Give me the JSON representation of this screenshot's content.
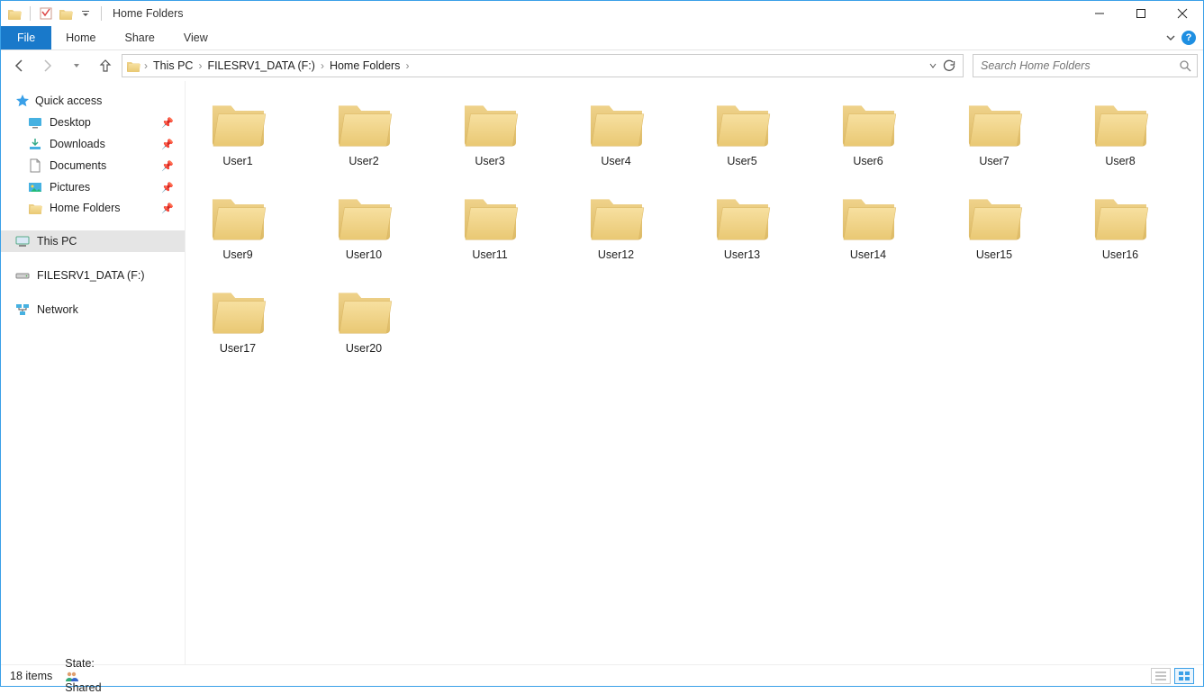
{
  "title": "Home Folders",
  "ribbon": {
    "file": "File",
    "tabs": [
      "Home",
      "Share",
      "View"
    ]
  },
  "breadcrumbs": [
    "This PC",
    "FILESRV1_DATA (F:)",
    "Home Folders"
  ],
  "search": {
    "placeholder": "Search Home Folders"
  },
  "sidebar": {
    "quick_access": "Quick access",
    "quick_items": [
      {
        "label": "Desktop",
        "icon": "desktop",
        "pinned": true
      },
      {
        "label": "Downloads",
        "icon": "downloads",
        "pinned": true
      },
      {
        "label": "Documents",
        "icon": "documents",
        "pinned": true
      },
      {
        "label": "Pictures",
        "icon": "pictures",
        "pinned": true
      },
      {
        "label": "Home Folders",
        "icon": "folder",
        "pinned": true
      }
    ],
    "this_pc": "This PC",
    "drive": "FILESRV1_DATA (F:)",
    "network": "Network"
  },
  "folders": [
    "User1",
    "User2",
    "User3",
    "User4",
    "User5",
    "User6",
    "User7",
    "User8",
    "User9",
    "User10",
    "User11",
    "User12",
    "User13",
    "User14",
    "User15",
    "User16",
    "User17",
    "User20"
  ],
  "status": {
    "count": "18 items",
    "state_label": "State:",
    "state_value": "Shared"
  }
}
